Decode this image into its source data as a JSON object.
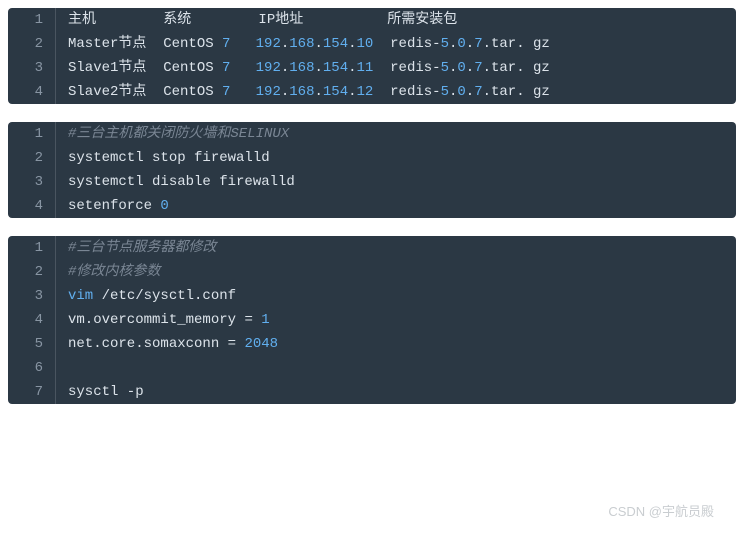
{
  "block1": {
    "lines": [
      [
        {
          "t": "主机        系统        IP地址          所需安装包",
          "c": "tk-text"
        }
      ],
      [
        {
          "t": "Master节点  CentOS ",
          "c": "tk-text"
        },
        {
          "t": "7",
          "c": "tk-cyan"
        },
        {
          "t": "   ",
          "c": "tk-text"
        },
        {
          "t": "192",
          "c": "tk-cyan"
        },
        {
          "t": ".",
          "c": "tk-dot"
        },
        {
          "t": "168",
          "c": "tk-cyan"
        },
        {
          "t": ".",
          "c": "tk-dot"
        },
        {
          "t": "154",
          "c": "tk-cyan"
        },
        {
          "t": ".",
          "c": "tk-dot"
        },
        {
          "t": "10",
          "c": "tk-cyan"
        },
        {
          "t": "  redis-",
          "c": "tk-text"
        },
        {
          "t": "5",
          "c": "tk-cyan"
        },
        {
          "t": ".",
          "c": "tk-dot"
        },
        {
          "t": "0",
          "c": "tk-cyan"
        },
        {
          "t": ".",
          "c": "tk-dot"
        },
        {
          "t": "7",
          "c": "tk-cyan"
        },
        {
          "t": ".tar. gz",
          "c": "tk-text"
        }
      ],
      [
        {
          "t": "Slave1节点  CentOS ",
          "c": "tk-text"
        },
        {
          "t": "7",
          "c": "tk-cyan"
        },
        {
          "t": "   ",
          "c": "tk-text"
        },
        {
          "t": "192",
          "c": "tk-cyan"
        },
        {
          "t": ".",
          "c": "tk-dot"
        },
        {
          "t": "168",
          "c": "tk-cyan"
        },
        {
          "t": ".",
          "c": "tk-dot"
        },
        {
          "t": "154",
          "c": "tk-cyan"
        },
        {
          "t": ".",
          "c": "tk-dot"
        },
        {
          "t": "11",
          "c": "tk-cyan"
        },
        {
          "t": "  redis-",
          "c": "tk-text"
        },
        {
          "t": "5",
          "c": "tk-cyan"
        },
        {
          "t": ".",
          "c": "tk-dot"
        },
        {
          "t": "0",
          "c": "tk-cyan"
        },
        {
          "t": ".",
          "c": "tk-dot"
        },
        {
          "t": "7",
          "c": "tk-cyan"
        },
        {
          "t": ".tar. gz",
          "c": "tk-text"
        }
      ],
      [
        {
          "t": "Slave2节点  CentOS ",
          "c": "tk-text"
        },
        {
          "t": "7",
          "c": "tk-cyan"
        },
        {
          "t": "   ",
          "c": "tk-text"
        },
        {
          "t": "192",
          "c": "tk-cyan"
        },
        {
          "t": ".",
          "c": "tk-dot"
        },
        {
          "t": "168",
          "c": "tk-cyan"
        },
        {
          "t": ".",
          "c": "tk-dot"
        },
        {
          "t": "154",
          "c": "tk-cyan"
        },
        {
          "t": ".",
          "c": "tk-dot"
        },
        {
          "t": "12",
          "c": "tk-cyan"
        },
        {
          "t": "  redis-",
          "c": "tk-text"
        },
        {
          "t": "5",
          "c": "tk-cyan"
        },
        {
          "t": ".",
          "c": "tk-dot"
        },
        {
          "t": "0",
          "c": "tk-cyan"
        },
        {
          "t": ".",
          "c": "tk-dot"
        },
        {
          "t": "7",
          "c": "tk-cyan"
        },
        {
          "t": ".tar. gz",
          "c": "tk-text"
        }
      ]
    ]
  },
  "block2": {
    "lines": [
      [
        {
          "t": "#三台主机都关闭防火墙和SELINUX",
          "c": "tk-comment"
        }
      ],
      [
        {
          "t": "systemctl stop firewalld",
          "c": "tk-text"
        }
      ],
      [
        {
          "t": "systemctl disable firewalld",
          "c": "tk-text"
        }
      ],
      [
        {
          "t": "setenforce ",
          "c": "tk-text"
        },
        {
          "t": "0",
          "c": "tk-cyan"
        }
      ]
    ]
  },
  "block3": {
    "lines": [
      [
        {
          "t": "#三台节点服务器都修改",
          "c": "tk-comment"
        }
      ],
      [
        {
          "t": "#修改内核参数",
          "c": "tk-comment"
        }
      ],
      [
        {
          "t": "vim",
          "c": "tk-cyan"
        },
        {
          "t": " /etc/sysctl.conf",
          "c": "tk-text"
        }
      ],
      [
        {
          "t": "vm.overcommit_memory ",
          "c": "tk-text"
        },
        {
          "t": "=",
          "c": "tk-op"
        },
        {
          "t": " ",
          "c": "tk-text"
        },
        {
          "t": "1",
          "c": "tk-cyan"
        }
      ],
      [
        {
          "t": "net.core.somaxconn ",
          "c": "tk-text"
        },
        {
          "t": "=",
          "c": "tk-op"
        },
        {
          "t": " ",
          "c": "tk-text"
        },
        {
          "t": "2048",
          "c": "tk-cyan"
        }
      ],
      [],
      [
        {
          "t": "sysctl -p",
          "c": "tk-text"
        }
      ]
    ]
  },
  "watermark": "CSDN @宇航员殿"
}
